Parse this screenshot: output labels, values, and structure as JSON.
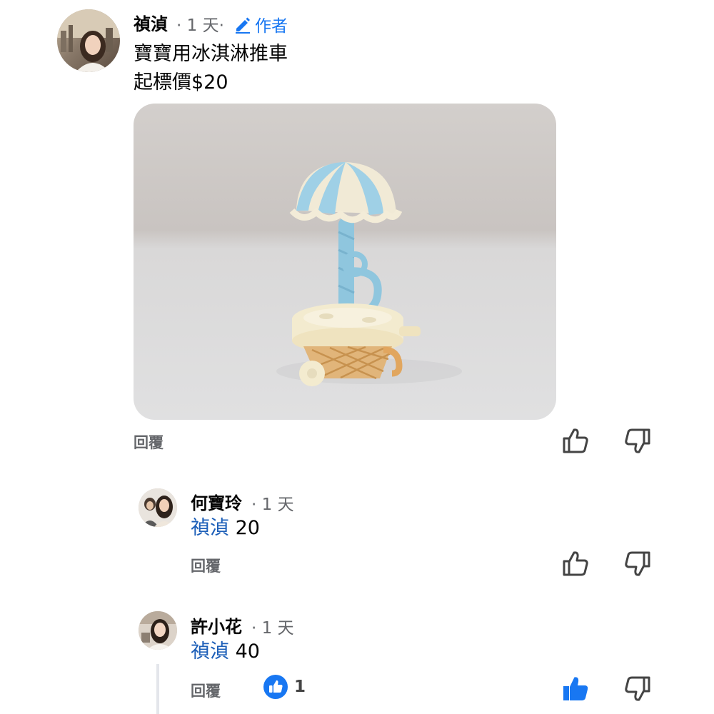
{
  "comments": [
    {
      "author": "禎湞",
      "time": "· 1 天·",
      "badge": "作者",
      "lines": [
        "寶寶用冰淇淋推車",
        "起標價$20"
      ],
      "reply_label": "回覆"
    },
    {
      "author": "何寶玲",
      "time": "· 1 天",
      "mention": "禎湞",
      "text": "20",
      "reply_label": "回覆"
    },
    {
      "author": "許小花",
      "time": "· 1 天",
      "mention": "禎湞",
      "text": "40",
      "reply_label": "回覆",
      "like_count": "1",
      "liked": true
    }
  ],
  "colors": {
    "accent": "#1877f2",
    "mention": "#1d5fb8",
    "muted": "#65676b"
  },
  "icons": [
    "thumbs-up-icon",
    "thumbs-down-icon",
    "pencil-icon"
  ]
}
